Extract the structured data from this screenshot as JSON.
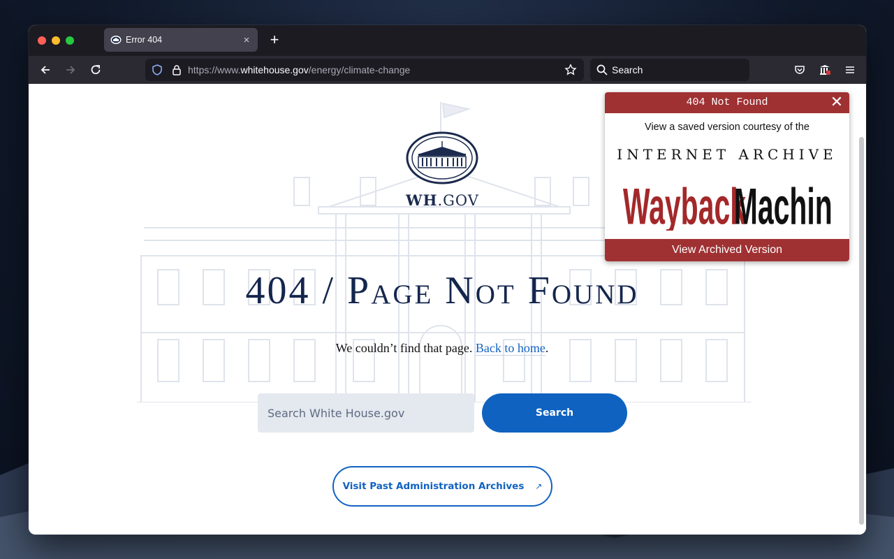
{
  "browser": {
    "tab_title": "Error 404",
    "tab_close": "×",
    "new_tab": "+",
    "url_prefix": "https://www.",
    "url_domain": "whitehouse.gov",
    "url_path": "/energy/climate-change",
    "search_placeholder": "Search"
  },
  "page": {
    "seal_wh": "WH",
    "seal_gov": ".GOV",
    "headline": "404 / Page Not Found",
    "sub_text": "We couldn’t find that page.",
    "sub_link": "Back to home",
    "sub_end": ".",
    "search_placeholder": "Search White House.gov",
    "search_button": "Search",
    "archive_link": "Visit Past Administration Archives",
    "archive_arrow": "↗"
  },
  "wayback": {
    "header": "404 Not Found",
    "close": "✕",
    "courtesy": "View a saved version courtesy of the",
    "ia_text": "INTERNET ARCHIVE",
    "logo_word1": "Wayback",
    "logo_word2": "Machine",
    "button": "View Archived Version"
  },
  "colors": {
    "navy": "#14264d",
    "link_blue": "#1162c1",
    "wayback_red": "#9f3133",
    "browser_dark": "#1c1b22"
  }
}
